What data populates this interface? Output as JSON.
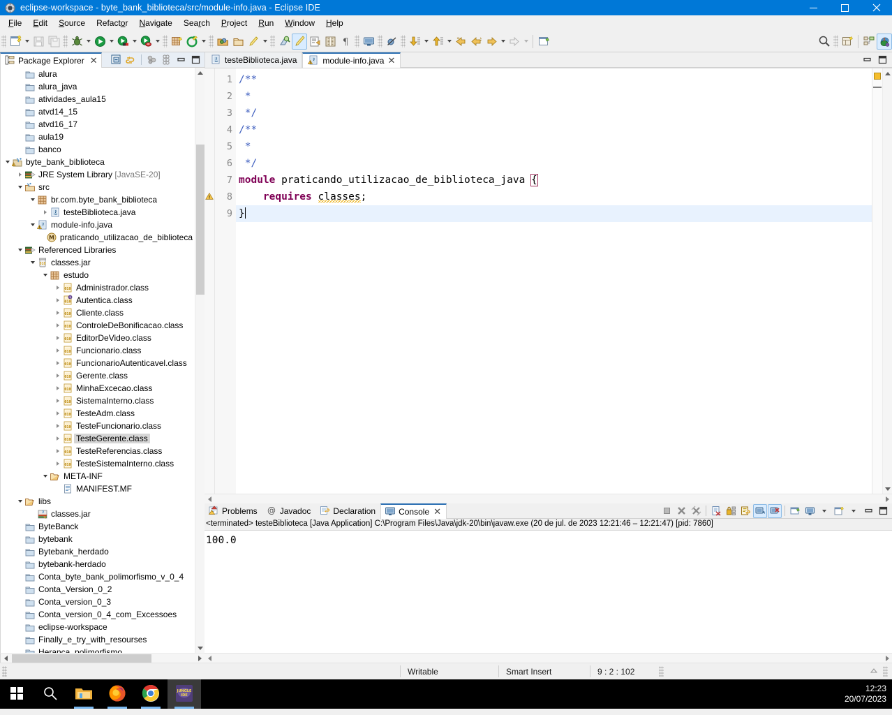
{
  "window": {
    "title": "eclipse-workspace - byte_bank_biblioteca/src/module-info.java - Eclipse IDE",
    "icon": "eclipse-icon",
    "minimize": "minimize-icon",
    "maximize": "maximize-icon",
    "close": "close-icon"
  },
  "menubar": {
    "items": [
      {
        "label": "File",
        "pre": "F",
        "mid": "ile"
      },
      {
        "label": "Edit",
        "pre": "E",
        "mid": "dit"
      },
      {
        "label": "Source",
        "pre": "S",
        "mid": "ource"
      },
      {
        "label": "Refactor",
        "pre": "Refact",
        "mid": "or"
      },
      {
        "label": "Navigate",
        "pre": "N",
        "mid": "avigate"
      },
      {
        "label": "Search",
        "pre": "Sea",
        "mid": "rch"
      },
      {
        "label": "Project",
        "pre": "P",
        "mid": "roject"
      },
      {
        "label": "Run",
        "pre": "R",
        "mid": "un"
      },
      {
        "label": "Window",
        "pre": "W",
        "mid": "indow"
      },
      {
        "label": "Help",
        "pre": "H",
        "mid": "elp"
      }
    ]
  },
  "toolbar": {
    "buttons": [
      "new-wizard-icon",
      "save-icon",
      "save-all-icon",
      "debug-icon",
      "run-icon",
      "coverage-icon",
      "profile-icon",
      "new-java-package-icon",
      "external-tools-icon",
      "open-type-icon",
      "open-task-icon",
      "quick-access-icon",
      "toggle-mark-occurrences-icon",
      "new-java-class-icon",
      "show-whitespace-icon",
      "paragraph-icon",
      "open-console-icon",
      "skip-breakpoints-icon",
      "next-annotation-icon",
      "previous-annotation-icon",
      "last-edit-location-icon",
      "back-icon",
      "forward-icon",
      "new-editor-icon",
      "search-icon",
      "new-perspective-icon",
      "java-browsing-perspective-icon",
      "java-perspective-icon"
    ]
  },
  "package_explorer": {
    "tab_title": "Package Explorer",
    "tab_icon": "package-explorer-icon",
    "close_icon": "close-icon",
    "tools": [
      "collapse-all-icon",
      "link-with-editor-icon",
      "view-menu-icon",
      "filters-icon",
      "minimize-icon",
      "maximize-icon"
    ],
    "tree": [
      {
        "label": "alura",
        "indent": 1,
        "arrow": "",
        "icon": "closed-project-icon"
      },
      {
        "label": "alura_java",
        "indent": 1,
        "arrow": "",
        "icon": "closed-project-icon"
      },
      {
        "label": "atividades_aula15",
        "indent": 1,
        "arrow": "",
        "icon": "closed-project-icon"
      },
      {
        "label": "atvd14_15",
        "indent": 1,
        "arrow": "",
        "icon": "closed-project-icon"
      },
      {
        "label": "atvd16_17",
        "indent": 1,
        "arrow": "",
        "icon": "closed-project-icon"
      },
      {
        "label": "aula19",
        "indent": 1,
        "arrow": "",
        "icon": "closed-project-icon"
      },
      {
        "label": "banco",
        "indent": 1,
        "arrow": "",
        "icon": "closed-project-icon"
      },
      {
        "label": "byte_bank_biblioteca",
        "indent": 0,
        "arrow": "d",
        "icon": "java-project-warning-icon"
      },
      {
        "label": "JRE System Library",
        "indent": 1,
        "arrow": "r",
        "icon": "library-icon",
        "suffix": "[JavaSE-20]"
      },
      {
        "label": "src",
        "indent": 1,
        "arrow": "d",
        "icon": "source-folder-icon"
      },
      {
        "label": "br.com.byte_bank_biblioteca",
        "indent": 2,
        "arrow": "d",
        "icon": "package-icon"
      },
      {
        "label": "testeBiblioteca.java",
        "indent": 3,
        "arrow": "r",
        "icon": "java-file-icon"
      },
      {
        "label": "module-info.java",
        "indent": 2,
        "arrow": "d",
        "icon": "java-file-warning-icon"
      },
      {
        "label": "praticando_utilizacao_de_biblioteca",
        "indent": 3,
        "arrow": "",
        "icon": "module-icon"
      },
      {
        "label": "Referenced Libraries",
        "indent": 1,
        "arrow": "d",
        "icon": "library-icon"
      },
      {
        "label": "classes.jar",
        "indent": 2,
        "arrow": "d",
        "icon": "jar-icon"
      },
      {
        "label": "estudo",
        "indent": 3,
        "arrow": "d",
        "icon": "package-icon"
      },
      {
        "label": "Administrador.class",
        "indent": 4,
        "arrow": "r",
        "icon": "class-file-icon"
      },
      {
        "label": "Autentica.class",
        "indent": 4,
        "arrow": "r",
        "icon": "interface-class-file-icon"
      },
      {
        "label": "Cliente.class",
        "indent": 4,
        "arrow": "r",
        "icon": "class-file-icon"
      },
      {
        "label": "ControleDeBonificacao.class",
        "indent": 4,
        "arrow": "r",
        "icon": "class-file-icon"
      },
      {
        "label": "EditorDeVideo.class",
        "indent": 4,
        "arrow": "r",
        "icon": "class-file-icon"
      },
      {
        "label": "Funcionario.class",
        "indent": 4,
        "arrow": "r",
        "icon": "class-file-icon"
      },
      {
        "label": "FuncionarioAutenticavel.class",
        "indent": 4,
        "arrow": "r",
        "icon": "class-file-icon"
      },
      {
        "label": "Gerente.class",
        "indent": 4,
        "arrow": "r",
        "icon": "class-file-icon"
      },
      {
        "label": "MinhaExcecao.class",
        "indent": 4,
        "arrow": "r",
        "icon": "class-file-icon"
      },
      {
        "label": "SistemaInterno.class",
        "indent": 4,
        "arrow": "r",
        "icon": "class-file-icon"
      },
      {
        "label": "TesteAdm.class",
        "indent": 4,
        "arrow": "r",
        "icon": "class-file-icon"
      },
      {
        "label": "TesteFuncionario.class",
        "indent": 4,
        "arrow": "r",
        "icon": "class-file-icon"
      },
      {
        "label": "TesteGerente.class",
        "indent": 4,
        "arrow": "r",
        "icon": "class-file-icon",
        "selected": true
      },
      {
        "label": "TesteReferencias.class",
        "indent": 4,
        "arrow": "r",
        "icon": "class-file-icon"
      },
      {
        "label": "TesteSistemaInterno.class",
        "indent": 4,
        "arrow": "r",
        "icon": "class-file-icon"
      },
      {
        "label": "META-INF",
        "indent": 3,
        "arrow": "d",
        "icon": "open-folder-icon"
      },
      {
        "label": "MANIFEST.MF",
        "indent": 4,
        "arrow": "",
        "icon": "manifest-file-icon"
      },
      {
        "label": "libs",
        "indent": 1,
        "arrow": "d",
        "icon": "open-folder-icon"
      },
      {
        "label": "classes.jar",
        "indent": 2,
        "arrow": "",
        "icon": "jar-resource-icon"
      },
      {
        "label": "ByteBanck",
        "indent": 1,
        "arrow": "",
        "icon": "closed-project-icon"
      },
      {
        "label": "bytebank",
        "indent": 1,
        "arrow": "",
        "icon": "closed-project-icon"
      },
      {
        "label": "Bytebank_herdado",
        "indent": 1,
        "arrow": "",
        "icon": "closed-project-icon"
      },
      {
        "label": "bytebank-herdado",
        "indent": 1,
        "arrow": "",
        "icon": "closed-project-icon"
      },
      {
        "label": "Conta_byte_bank_polimorfismo_v_0_4",
        "indent": 1,
        "arrow": "",
        "icon": "closed-project-icon"
      },
      {
        "label": "Conta_Version_0_2",
        "indent": 1,
        "arrow": "",
        "icon": "closed-project-icon"
      },
      {
        "label": "Conta_version_0_3",
        "indent": 1,
        "arrow": "",
        "icon": "closed-project-icon"
      },
      {
        "label": "Conta_version_0_4_com_Excessoes",
        "indent": 1,
        "arrow": "",
        "icon": "closed-project-icon"
      },
      {
        "label": "eclipse-workspace",
        "indent": 1,
        "arrow": "",
        "icon": "closed-project-icon"
      },
      {
        "label": "Finally_e_try_with_resourses",
        "indent": 1,
        "arrow": "",
        "icon": "closed-project-icon"
      },
      {
        "label": "Heranca_polimorfismo",
        "indent": 1,
        "arrow": "",
        "icon": "closed-project-icon"
      }
    ]
  },
  "editor": {
    "tabs": [
      {
        "label": "testeBiblioteca.java",
        "icon": "java-file-icon",
        "active": false,
        "closable": false
      },
      {
        "label": "module-info.java",
        "icon": "java-file-warning-icon",
        "active": true,
        "closable": true
      }
    ],
    "tools": [
      "minimize-icon",
      "maximize-icon"
    ],
    "lines": [
      {
        "n": "1",
        "segments": [
          {
            "t": "/**",
            "c": "cmt"
          }
        ]
      },
      {
        "n": "2",
        "segments": [
          {
            "t": " *",
            "c": "cmt"
          }
        ]
      },
      {
        "n": "3",
        "segments": [
          {
            "t": " */",
            "c": "cmt"
          }
        ]
      },
      {
        "n": "4",
        "segments": [
          {
            "t": "/**",
            "c": "cmt"
          }
        ]
      },
      {
        "n": "5",
        "segments": [
          {
            "t": " *",
            "c": "cmt"
          }
        ]
      },
      {
        "n": "6",
        "segments": [
          {
            "t": " */",
            "c": "cmt"
          }
        ]
      },
      {
        "n": "7",
        "segments": [
          {
            "t": "module",
            "c": "kw"
          },
          {
            "t": " praticando_utilizacao_de_biblioteca_java ",
            "c": "pl"
          },
          {
            "t": "{",
            "c": "brmatch"
          }
        ]
      },
      {
        "n": "8",
        "marker": "warning-marker-icon",
        "segments": [
          {
            "t": "    ",
            "c": "pl"
          },
          {
            "t": "requires",
            "c": "kw"
          },
          {
            "t": " ",
            "c": "pl"
          },
          {
            "t": "classes",
            "c": "warnu"
          },
          {
            "t": ";",
            "c": "pl"
          }
        ]
      },
      {
        "n": "9",
        "current": true,
        "caret": true,
        "segments": [
          {
            "t": "}",
            "c": "pl"
          }
        ]
      }
    ],
    "overview_marker": "warning-overview-marker"
  },
  "console_panel": {
    "tabs": [
      {
        "label": "Problems",
        "icon": "problems-icon",
        "active": false,
        "closable": false
      },
      {
        "label": "Javadoc",
        "icon": "javadoc-icon",
        "active": false,
        "closable": false
      },
      {
        "label": "Declaration",
        "icon": "declaration-icon",
        "active": false,
        "closable": false
      },
      {
        "label": "Console",
        "icon": "console-icon",
        "active": true,
        "closable": true
      }
    ],
    "tools": [
      "terminate-icon",
      "remove-launch-icon",
      "remove-all-terminated-icon",
      "clear-console-icon",
      "scroll-lock-icon",
      "word-wrap-icon",
      "pin-console-icon",
      "display-selected-console-icon",
      "open-console-icon",
      "display-console-icon",
      "new-console-view-icon",
      "minimize-icon",
      "maximize-icon"
    ],
    "launch_line": "<terminated> testeBiblioteca [Java Application] C:\\Program Files\\Java\\jdk-20\\bin\\javaw.exe  (20 de jul. de 2023 12:21:46 – 12:21:47) [pid: 7860]",
    "output": "100.0"
  },
  "statusbar": {
    "writable": "Writable",
    "insert_mode": "Smart Insert",
    "position": "9 : 2 : 102"
  },
  "taskbar": {
    "items": [
      {
        "name": "start-button",
        "icon": "windows-logo-icon"
      },
      {
        "name": "search-taskbar",
        "icon": "search-icon"
      },
      {
        "name": "file-explorer",
        "icon": "folder-icon",
        "running": true
      },
      {
        "name": "firefox",
        "icon": "firefox-icon",
        "running": true
      },
      {
        "name": "google-chrome",
        "icon": "chrome-icon",
        "running": true
      },
      {
        "name": "eclipse-ide",
        "icon": "eclipse-icon",
        "running": true,
        "active": true
      }
    ],
    "clock_time": "12:23",
    "clock_date": "20/07/2023"
  }
}
